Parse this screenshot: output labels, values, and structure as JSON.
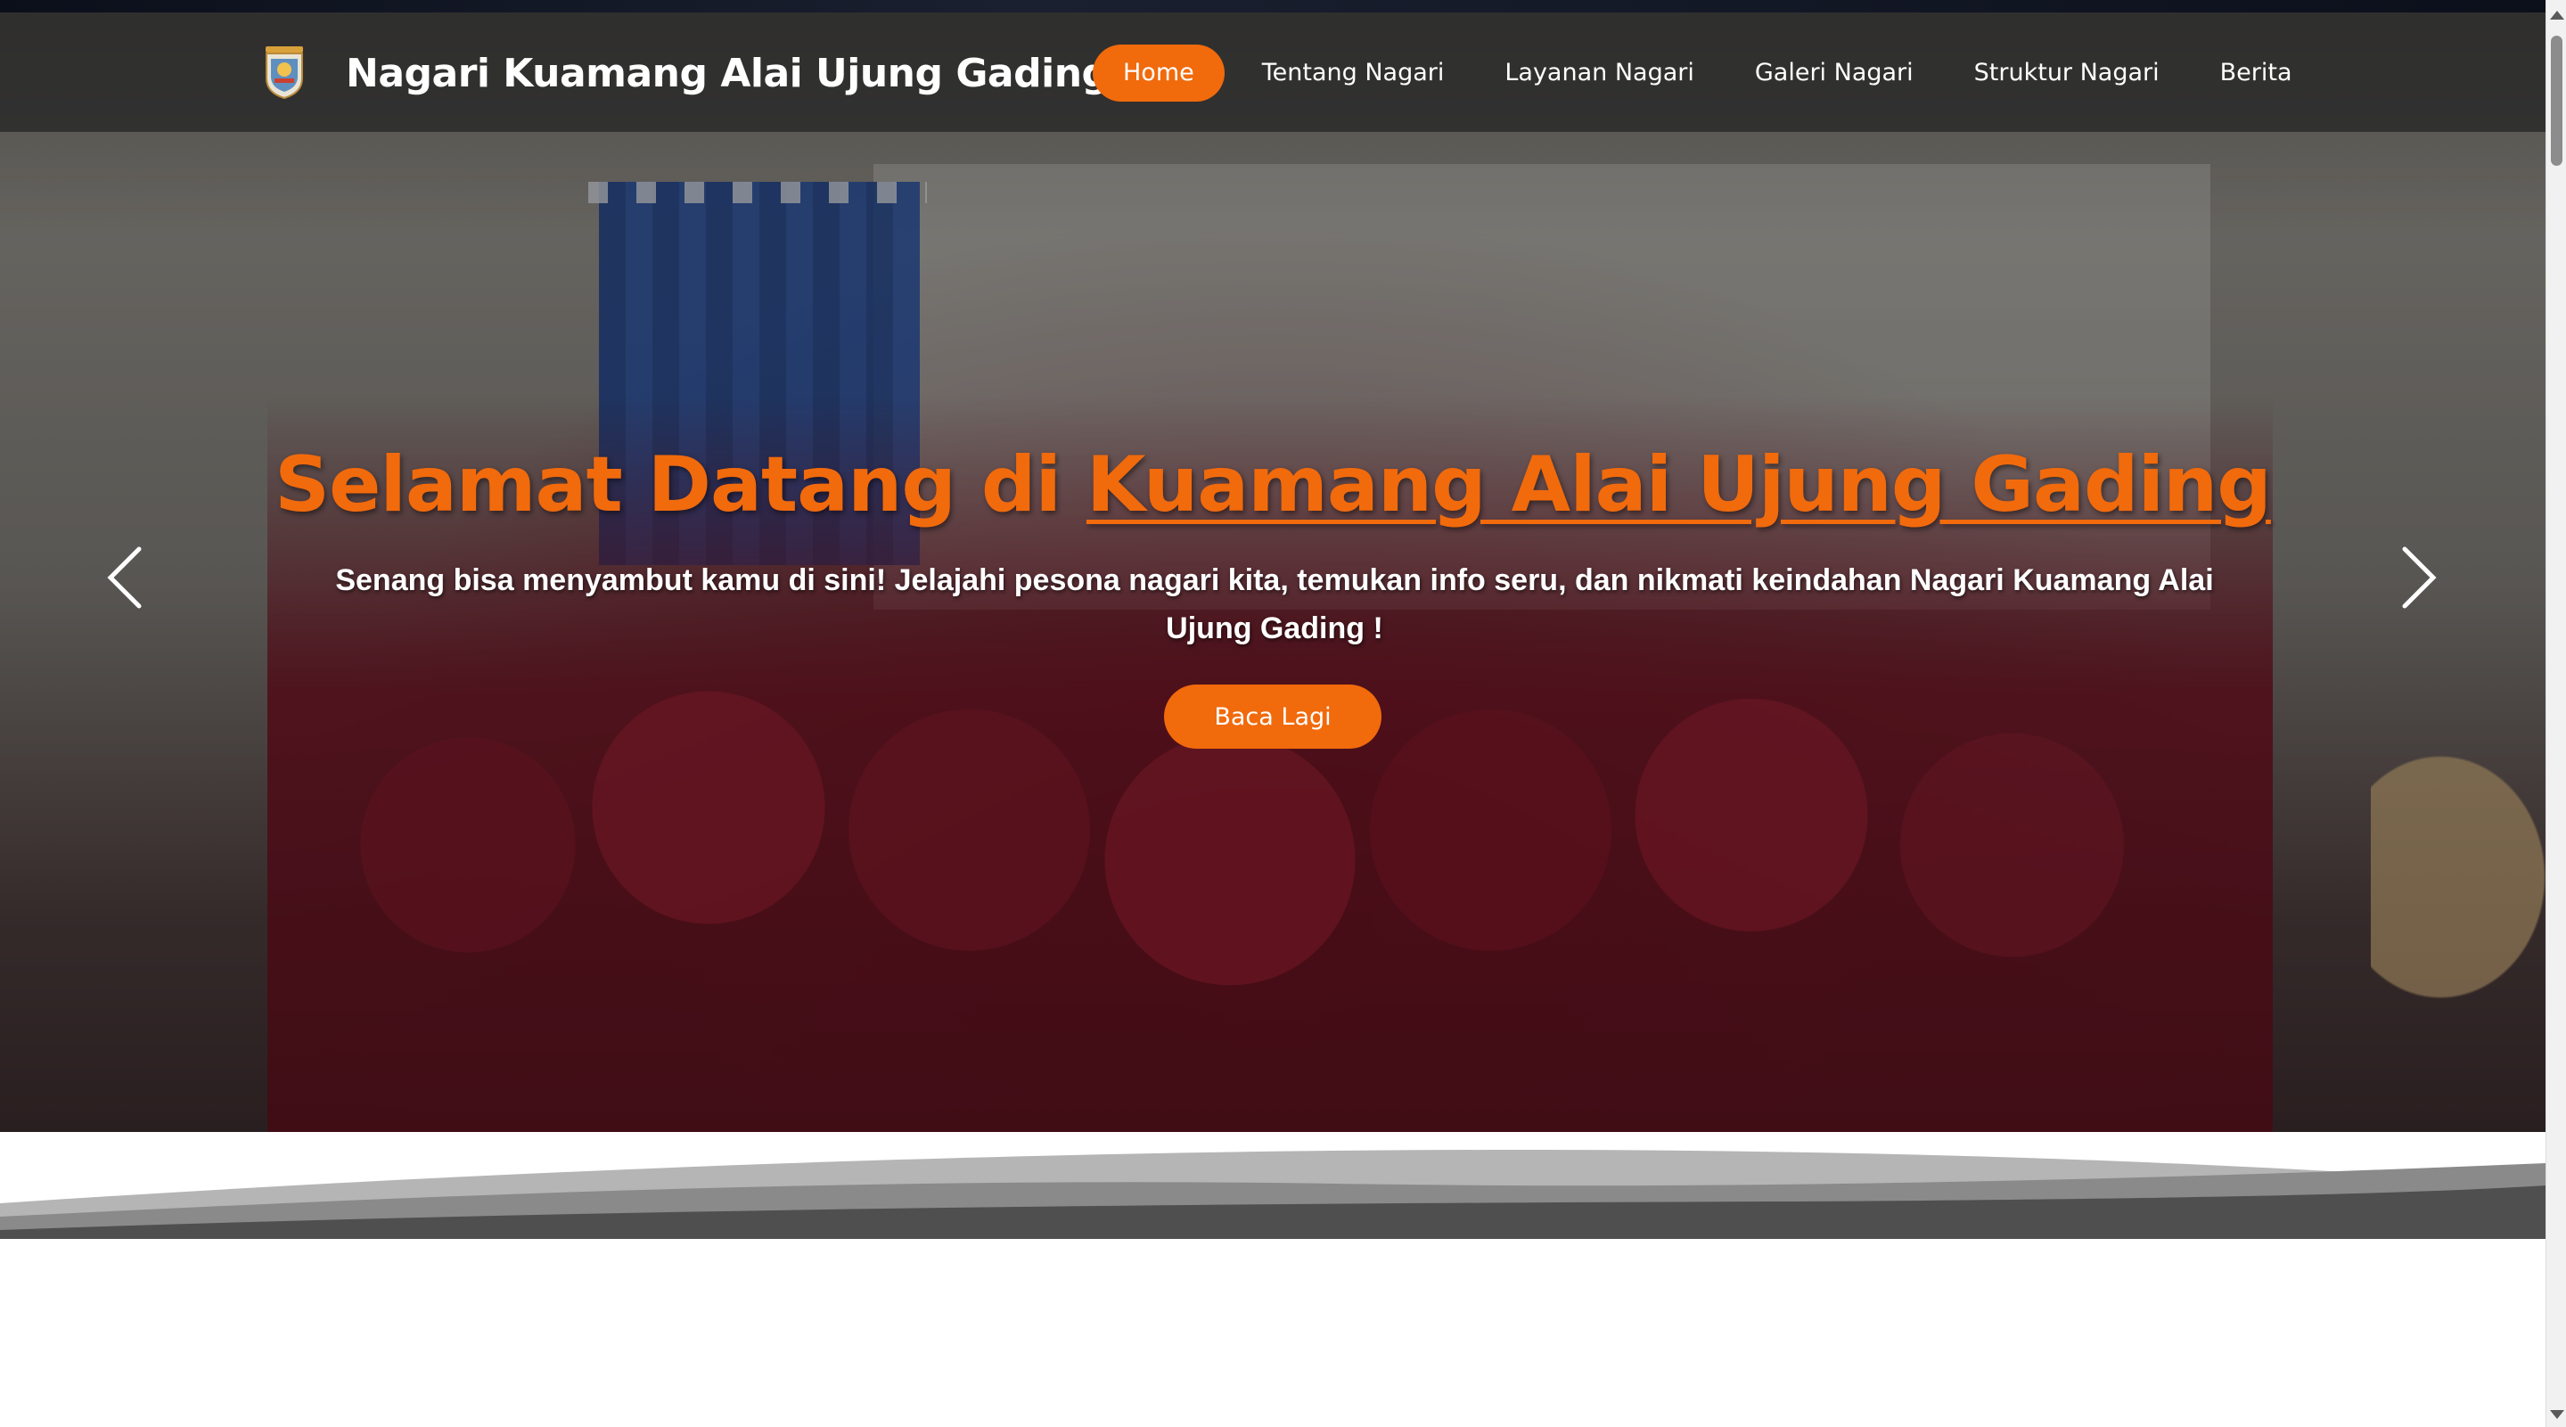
{
  "brand": {
    "name": "Nagari Kuamang Alai Ujung Gading",
    "logo_icon": "nagari-crest-icon"
  },
  "nav": {
    "items": [
      {
        "label": "Home",
        "active": true
      },
      {
        "label": "Tentang Nagari",
        "active": false
      },
      {
        "label": "Layanan Nagari",
        "active": false
      },
      {
        "label": "Galeri Nagari",
        "active": false
      },
      {
        "label": "Struktur Nagari",
        "active": false
      },
      {
        "label": "Berita",
        "active": false
      }
    ]
  },
  "hero": {
    "headline_prefix": "Selamat Datang di ",
    "headline_highlight": "Kuamang Alai Ujung Gading",
    "subtext": "Senang bisa menyambut kamu di sini! Jelajahi pesona nagari kita, temukan info seru, dan nikmati keindahan Nagari Kuamang Alai Ujung Gading !",
    "cta_label": "Baca Lagi",
    "prev_icon": "chevron-left-icon",
    "next_icon": "chevron-right-icon"
  },
  "colors": {
    "accent": "#f16a0c",
    "navbar_bg": "#282828",
    "text_light": "#ffffff"
  }
}
